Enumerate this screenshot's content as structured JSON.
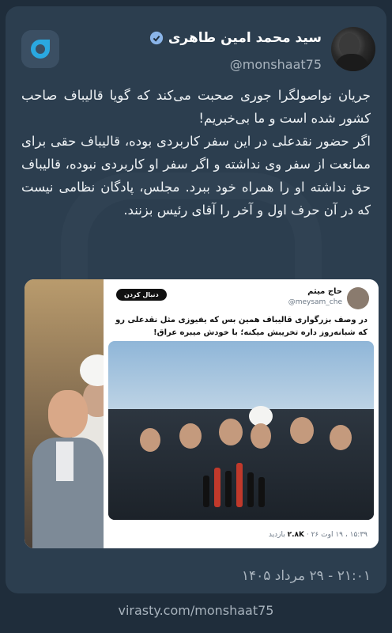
{
  "post": {
    "author_name": "سید محمد امین طاهری",
    "author_handle": "@monshaat75",
    "body_paragraphs": [
      "جریان نواصولگرا جوری صحبت می‌کند که گویا قالیباف صاحب کشور شده است و ما بی‌خبریم!",
      "اگر حضور نقدعلی در این سفر کاربردی بوده، قالیباف حقی برای ممانعت از سفر وی نداشته و اگر سفر او کاربردی نبوده، قالیباف حق نداشته او را همراه خود ببرد. مجلس، پادگان نظامی نیست که در آن حرف اول و آخر را آقای رئیس بزنند."
    ],
    "date_text": "۲۱:۰۱ - ۲۹ مرداد ۱۴۰۵"
  },
  "embedded_tweet": {
    "author_name": "حاج میثم",
    "author_handle": "@meysam_che",
    "follow_label": "دنبال کردن",
    "text": "در وصف بزرگواری قالیباف همین بس که یفیوزی مثل نقدعلی رو که شبانه‌روز داره تخریبش میکنه؛ با خودش میبره عراق!",
    "meta_time": "۱۵:۳۹ ، ۱۹ اوت ۲۶",
    "meta_views": "۲.۸K",
    "meta_views_label": "بازدید"
  },
  "footer": {
    "link_text": "virasty.com/monshaat75"
  },
  "colors": {
    "background": "#1f2d3b",
    "card": "#2c3e4f",
    "accent": "#6fa8dc"
  }
}
